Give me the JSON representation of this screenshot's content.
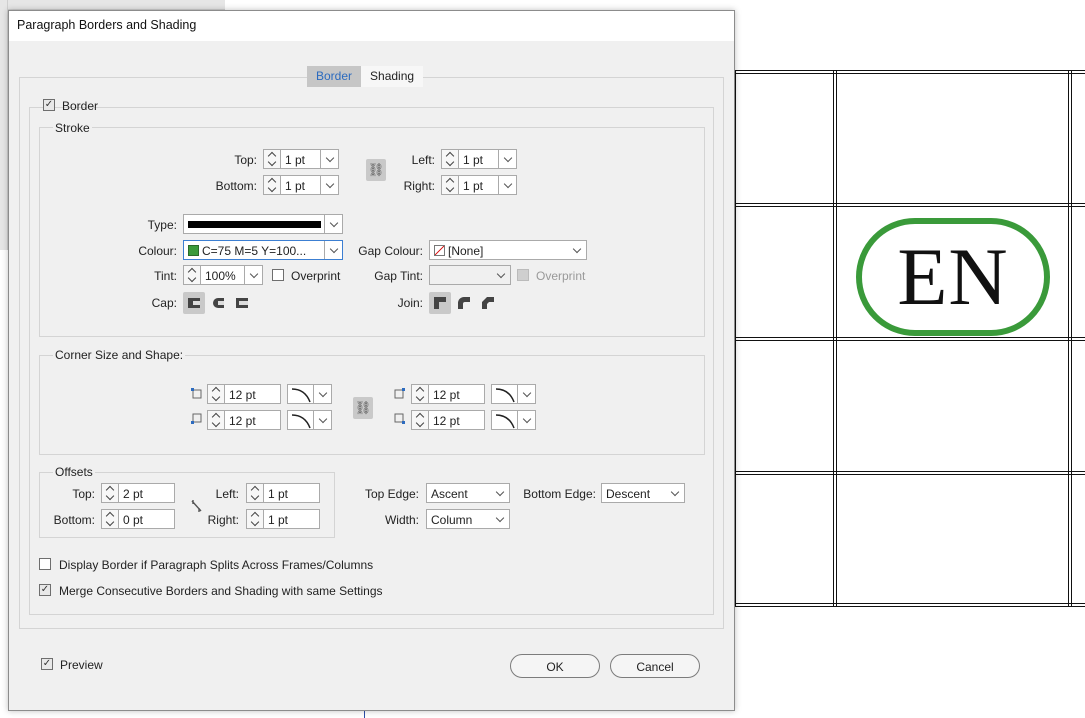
{
  "dialog": {
    "title": "Paragraph Borders and Shading",
    "tabs": [
      {
        "label": "Border",
        "active": true
      },
      {
        "label": "Shading",
        "active": false
      }
    ]
  },
  "border": {
    "checkbox_label": "Border",
    "checked": true
  },
  "stroke": {
    "section_label": "Stroke",
    "top_label": "Top:",
    "top_value": "1 pt",
    "bottom_label": "Bottom:",
    "bottom_value": "1 pt",
    "left_label": "Left:",
    "left_value": "1 pt",
    "right_label": "Right:",
    "right_value": "1 pt",
    "type_label": "Type:",
    "colour_label": "Colour:",
    "colour_value": "C=75 M=5 Y=100...",
    "colour_swatch": "#3a9a3a",
    "gap_colour_label": "Gap Colour:",
    "gap_colour_value": "[None]",
    "tint_label": "Tint:",
    "tint_value": "100%",
    "overprint_label": "Overprint",
    "gap_tint_label": "Gap Tint:",
    "gap_overprint_label": "Overprint",
    "cap_label": "Cap:",
    "join_label": "Join:"
  },
  "corner": {
    "section_label": "Corner Size and Shape:",
    "top_left_value": "12 pt",
    "bottom_left_value": "12 pt",
    "top_right_value": "12 pt",
    "bottom_right_value": "12 pt"
  },
  "offsets": {
    "section_label": "Offsets",
    "top_label": "Top:",
    "top_value": "2 pt",
    "bottom_label": "Bottom:",
    "bottom_value": "0 pt",
    "left_label": "Left:",
    "left_value": "1 pt",
    "right_label": "Right:",
    "right_value": "1 pt",
    "top_edge_label": "Top Edge:",
    "top_edge_value": "Ascent",
    "bottom_edge_label": "Bottom Edge:",
    "bottom_edge_value": "Descent",
    "width_label": "Width:",
    "width_value": "Column"
  },
  "options": {
    "display_split_label": "Display Border if Paragraph Splits Across Frames/Columns",
    "display_split_checked": false,
    "merge_label": "Merge Consecutive Borders and Shading with same Settings",
    "merge_checked": true
  },
  "footer": {
    "preview_label": "Preview",
    "preview_checked": true,
    "ok_label": "OK",
    "cancel_label": "Cancel"
  },
  "document": {
    "badge_text": "EN",
    "badge_color": "#3a9a3a"
  }
}
